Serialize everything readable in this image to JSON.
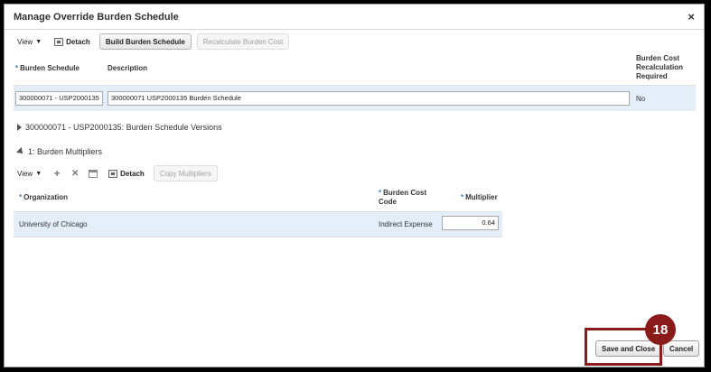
{
  "dialog": {
    "title": "Manage Override Burden Schedule",
    "close_label": "×"
  },
  "toolbar": {
    "view_label": "View",
    "detach_label": "Detach",
    "build_label": "Build Burden Schedule",
    "recalc_label": "Recalculate Burden Cost"
  },
  "schedule_table": {
    "headers": {
      "required_mark": "*",
      "burden_schedule": "Burden Schedule",
      "description": "Description",
      "recalc_line1": "Burden Cost",
      "recalc_line2": "Recalculation",
      "recalc_line3": "Required"
    },
    "row": {
      "burden_schedule": "300000071 - USP2000135",
      "description": "300000071 USP2000135 Burden Schedule",
      "recalc_required": "No"
    }
  },
  "sections": {
    "versions_label": "300000071 - USP2000135: Burden Schedule Versions",
    "multipliers_label": "1: Burden Multipliers"
  },
  "multipliers_toolbar": {
    "view_label": "View",
    "add_symbol": "+",
    "delete_symbol": "✕",
    "detach_label": "Detach",
    "copy_label": "Copy Multipliers"
  },
  "multipliers_table": {
    "headers": {
      "organization": "Organization",
      "burden_code_line1": "Burden Cost",
      "burden_code_line2": "Code",
      "multiplier": "Multiplier"
    },
    "row": {
      "organization": "University of Chicago",
      "burden_code": "Indirect Expense",
      "multiplier": "0.64"
    }
  },
  "footer": {
    "save_close_label": "Save and Close",
    "cancel_label": "Cancel"
  },
  "callout": {
    "step_number": "18"
  },
  "colors": {
    "accent_required": "#3c7ec0",
    "row_highlight": "#e4eef8",
    "callout": "#8b1a1a"
  }
}
